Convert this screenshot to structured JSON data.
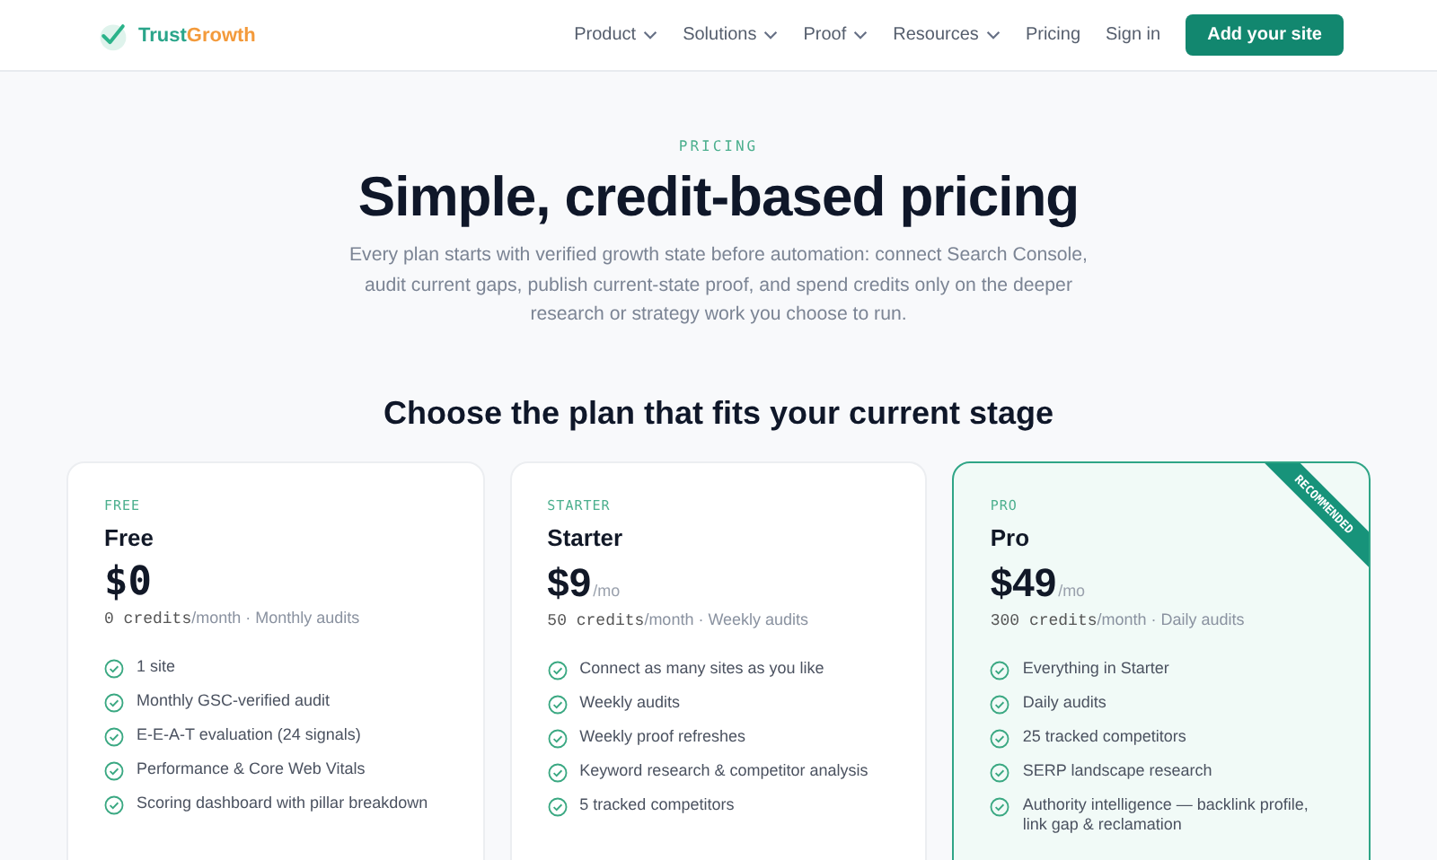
{
  "nav": {
    "brand": [
      "Trust",
      "Growth"
    ],
    "items": [
      {
        "label": "Product",
        "kind": "menu"
      },
      {
        "label": "Solutions",
        "kind": "menu"
      },
      {
        "label": "Proof",
        "kind": "menu"
      },
      {
        "label": "Resources",
        "kind": "menu"
      },
      {
        "label": "Pricing",
        "kind": "link"
      },
      {
        "label": "Sign in",
        "kind": "link"
      }
    ],
    "cta": "Add your site"
  },
  "hero": {
    "eyebrow": "PRICING",
    "title": "Simple, credit-based pricing",
    "lead": "Every plan starts with verified growth state before automation: connect Search Console, audit current gaps, publish current-state proof, and spend credits only on the deeper research or strategy work you choose to run."
  },
  "plans_heading": "Choose the plan that fits your current stage",
  "plans": [
    {
      "tier": "FREE",
      "name": "Free",
      "price": "$0",
      "credits": "0 credits",
      "cadence": "/month · Monthly audits",
      "recommended": false,
      "features": [
        "1 site",
        "Monthly GSC-verified audit",
        "E-E-A-T evaluation (24 signals)",
        "Performance & Core Web Vitals",
        "Scoring dashboard with pillar breakdown"
      ]
    },
    {
      "tier": "STARTER",
      "name": "Starter",
      "price": "$9",
      "period": "/mo",
      "credits": "50 credits",
      "cadence": "/month · Weekly audits",
      "recommended": false,
      "features": [
        "Connect as many sites as you like",
        "Weekly audits",
        "Weekly proof refreshes",
        "Keyword research & competitor analysis",
        "5 tracked competitors"
      ]
    },
    {
      "tier": "PRO",
      "name": "Pro",
      "price": "$49",
      "period": "/mo",
      "credits": "300 credits",
      "cadence": "/month · Daily audits",
      "recommended": true,
      "ribbon": "RECOMMENDED",
      "features": [
        "Everything in Starter",
        "Daily audits",
        "25 tracked competitors",
        "SERP landscape research",
        "Authority intelligence — backlink profile, link gap & reclamation"
      ]
    }
  ]
}
